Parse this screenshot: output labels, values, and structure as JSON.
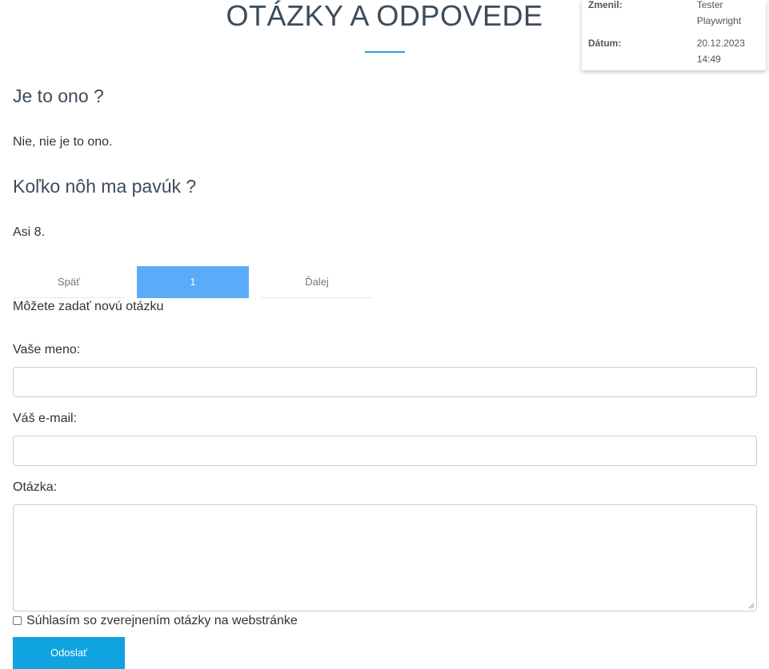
{
  "header": {
    "title": "OTÁZKY A ODPOVEDE"
  },
  "info_card": {
    "modified_by_label": "Zmenil:",
    "modified_by_value": "Tester Playwright",
    "date_label": "Dátum:",
    "date_value": "20.12.2023 14:49"
  },
  "faq": [
    {
      "question": "Je to ono ?",
      "answer": "Nie, nie je to ono."
    },
    {
      "question": "Koľko nôh ma pavúk ?",
      "answer": "Asi 8."
    }
  ],
  "pagination": {
    "prev_label": "Späť",
    "current_page": "1",
    "next_label": "Ďalej"
  },
  "form": {
    "intro": "Môžete zadať novú otázku",
    "name_label": "Vaše meno:",
    "name_value": "",
    "email_label": "Váš e-mail:",
    "email_value": "",
    "question_label": "Otázka:",
    "question_value": "",
    "consent_label": "Súhlasím so zverejnením otázky na webstránke",
    "consent_checked": false,
    "submit_label": "Odoslať"
  },
  "colors": {
    "accent": "#2ea3d4",
    "active_page": "#5aacf8",
    "submit": "#0fa3e0",
    "heading": "#3d4b5a"
  }
}
